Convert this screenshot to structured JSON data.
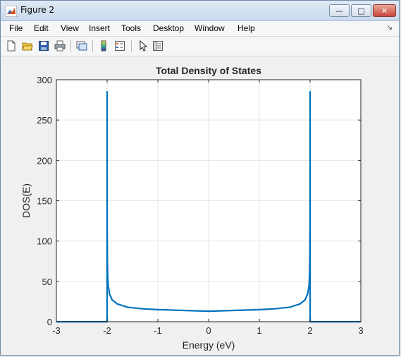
{
  "window": {
    "title": "Figure 2",
    "controls": {
      "minimize": "—",
      "maximize": "□",
      "close": "✕"
    }
  },
  "menu": {
    "items": [
      "File",
      "Edit",
      "View",
      "Insert",
      "Tools",
      "Desktop",
      "Window",
      "Help"
    ],
    "overflow_icon": "arrow-down-right-icon"
  },
  "toolbar": {
    "icons": [
      "new-figure-icon",
      "open-file-icon",
      "save-icon",
      "print-icon",
      "link-plot-icon",
      "insert-colorbar-icon",
      "insert-legend-icon",
      "edit-plot-pointer-icon",
      "property-inspector-icon"
    ]
  },
  "colors": {
    "line": "#0072BD",
    "axes_bg": "#ffffff",
    "figure_bg": "#f0f0f0",
    "grid": "#e6e6e6"
  },
  "chart_data": {
    "type": "line",
    "title": "Total Density of States",
    "xlabel": "Energy (eV)",
    "ylabel": "DOS(E)",
    "xlim": [
      -3,
      3
    ],
    "ylim": [
      0,
      300
    ],
    "xticks": [
      -3,
      -2,
      -1,
      0,
      1,
      2,
      3
    ],
    "yticks": [
      0,
      50,
      100,
      150,
      200,
      250,
      300
    ],
    "grid": true,
    "series": [
      {
        "x": [
          -3,
          -2.001,
          -2.0,
          -1.999,
          -1.995,
          -1.99,
          -1.98,
          -1.95,
          -1.9,
          -1.8,
          -1.6,
          -1.3,
          -1.0,
          -0.5,
          0,
          0.5,
          1.0,
          1.3,
          1.6,
          1.8,
          1.9,
          1.95,
          1.98,
          1.99,
          1.995,
          1.999,
          2.0,
          2.001,
          3
        ],
        "y": [
          0,
          0,
          285,
          120,
          80,
          60,
          45,
          34,
          27,
          22,
          18,
          16,
          15,
          14,
          13,
          14,
          15,
          16,
          18,
          22,
          27,
          34,
          45,
          60,
          80,
          120,
          285,
          0,
          0
        ]
      }
    ]
  }
}
